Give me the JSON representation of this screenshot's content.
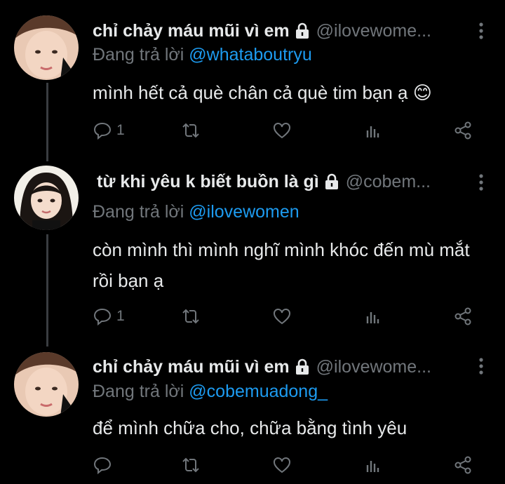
{
  "tweets": [
    {
      "display_name": "chỉ chảy máu mũi vì em",
      "handle": "@ilovewome...",
      "reply_prefix": "Đang trả lời ",
      "reply_to": "@whataboutryu",
      "text": "mình hết cả què chân cả què tim bạn ạ 😊",
      "reply_count": "1",
      "avatar": "avatar-girl-1"
    },
    {
      "display_name": "từ khi yêu k biết buồn là gì",
      "handle": "@cobem...",
      "reply_prefix": "Đang trả lời ",
      "reply_to": "@ilovewomen",
      "text": "còn mình thì mình nghĩ mình khóc đến mù mắt rồi bạn ạ",
      "reply_count": "1",
      "avatar": "avatar-girl-2"
    },
    {
      "display_name": "chỉ chảy máu mũi vì em",
      "handle": "@ilovewome...",
      "reply_prefix": "Đang trả lời ",
      "reply_to": "@cobemuadong_",
      "text": "để mình chữa cho, chữa bằng tình yêu",
      "reply_count": "",
      "avatar": "avatar-girl-1"
    }
  ],
  "colors": {
    "background": "#000000",
    "text": "#e7e9ea",
    "muted": "#71767b",
    "link": "#1d9bf0",
    "thread_line": "#3a3d41"
  },
  "icons": [
    "lock-icon",
    "more-vertical-icon",
    "reply-icon",
    "retweet-icon",
    "like-icon",
    "analytics-icon",
    "share-icon"
  ]
}
